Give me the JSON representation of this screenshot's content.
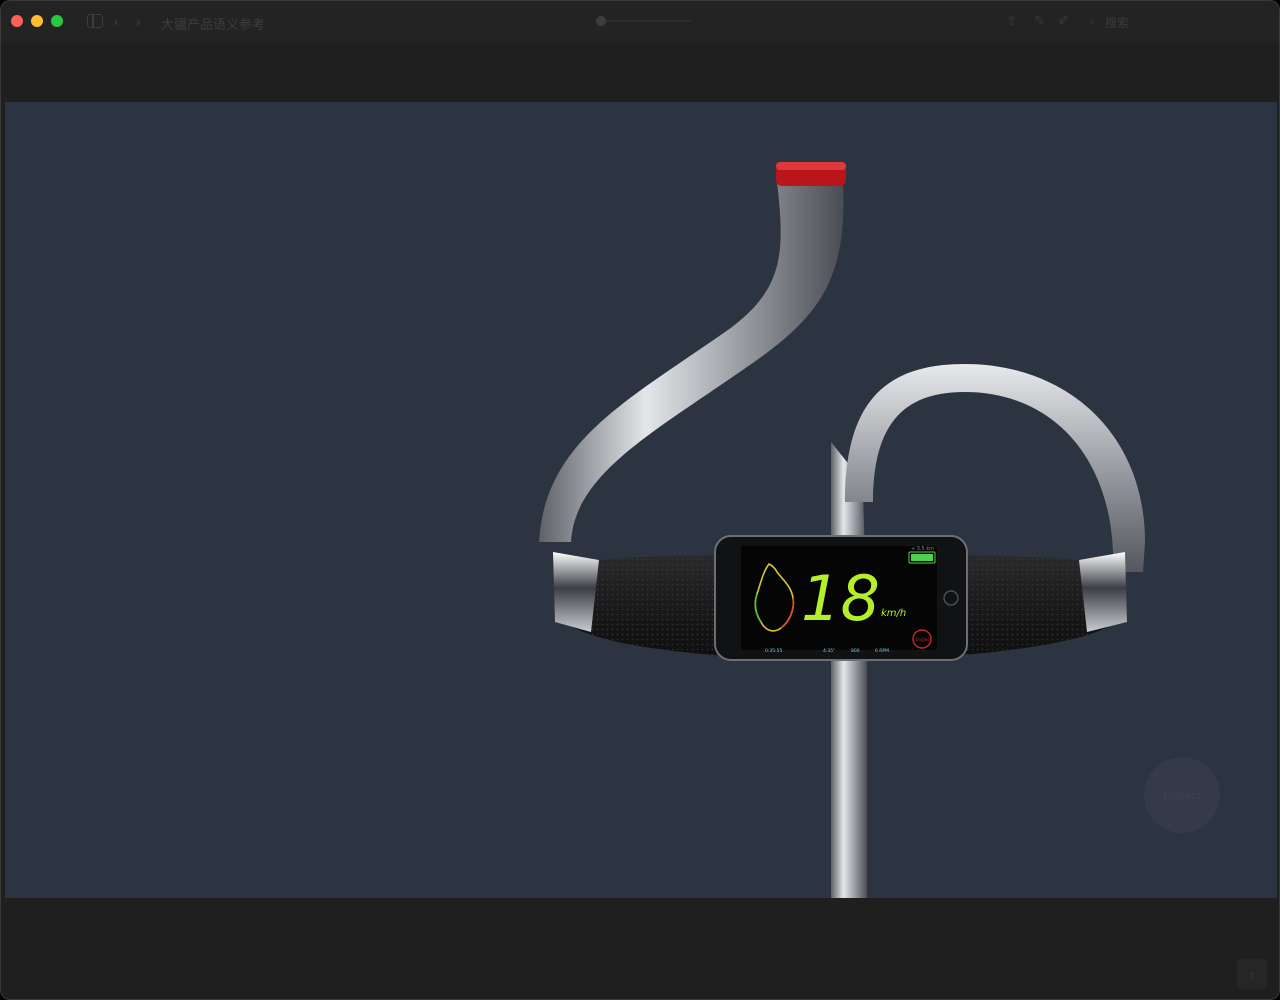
{
  "window": {
    "title": "大疆产品语义参考"
  },
  "toolbar": {
    "search_label": "搜索",
    "icons": [
      "sidebar-icon",
      "chevron-left-icon",
      "chevron-right-icon",
      "share-icon",
      "pen-icon",
      "markup-icon",
      "search-icon"
    ]
  },
  "colors": {
    "canvas_bg": "#2d3441",
    "speed_green": "#b5ef2a",
    "tail_light": "#c0161c"
  },
  "phone_display": {
    "distance": "+ 3.5 km",
    "speed": "18",
    "unit": "km/h",
    "engine_label": "Engine",
    "stats": [
      "0:35:55",
      "4:35\"",
      "800",
      "6 RPM"
    ]
  },
  "float_button": {
    "label": "Collect"
  },
  "scroll_top": {
    "label": "↑"
  }
}
